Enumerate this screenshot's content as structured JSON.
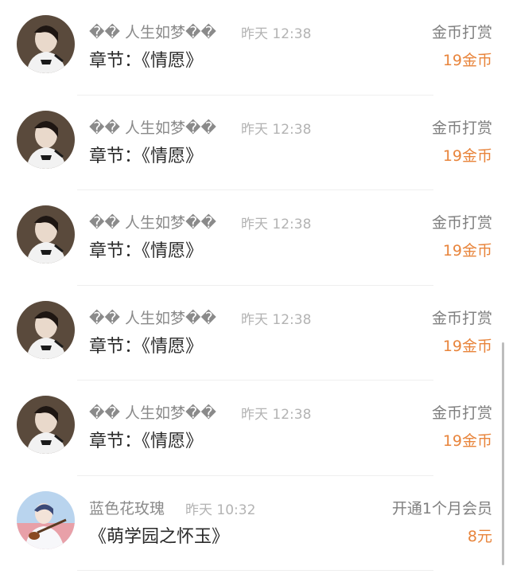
{
  "colors": {
    "amount": "#e8843b",
    "name": "#8a8a8a",
    "time": "#b3b3b3",
    "action": "#7f7f7f",
    "chapter": "#2a2a2a"
  },
  "items": [
    {
      "name": "�� 人生如梦��",
      "time": "昨天 12:38",
      "chapter": "章节：《情愿》",
      "action": "金币打赏",
      "amount": "19金币",
      "avatar_icon": "woman-avatar-icon"
    },
    {
      "name": "�� 人生如梦��",
      "time": "昨天 12:38",
      "chapter": "章节：《情愿》",
      "action": "金币打赏",
      "amount": "19金币",
      "avatar_icon": "woman-avatar-icon"
    },
    {
      "name": "�� 人生如梦��",
      "time": "昨天 12:38",
      "chapter": "章节：《情愿》",
      "action": "金币打赏",
      "amount": "19金币",
      "avatar_icon": "woman-avatar-icon"
    },
    {
      "name": "�� 人生如梦��",
      "time": "昨天 12:38",
      "chapter": "章节：《情愿》",
      "action": "金币打赏",
      "amount": "19金币",
      "avatar_icon": "woman-avatar-icon"
    },
    {
      "name": "�� 人生如梦��",
      "time": "昨天 12:38",
      "chapter": "章节：《情愿》",
      "action": "金币打赏",
      "amount": "19金币",
      "avatar_icon": "woman-avatar-icon"
    },
    {
      "name": "蓝色花玫瑰",
      "time": "昨天 10:32",
      "chapter": "《萌学园之怀玉》",
      "action": "开通1个月会员",
      "amount": "8元",
      "avatar_icon": "violinist-avatar-icon"
    }
  ]
}
